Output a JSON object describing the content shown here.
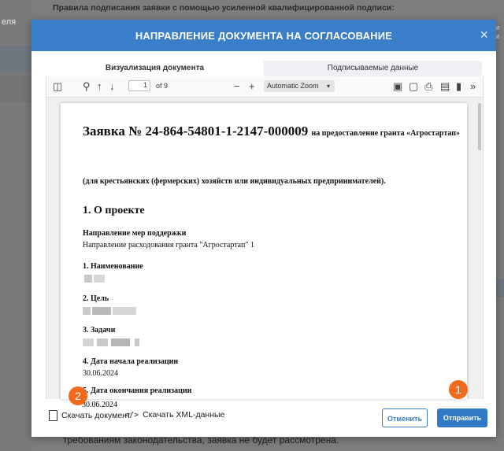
{
  "background": {
    "left_label": "еля",
    "top_text": "Правила подписания заявки с помощью усиленной квалифицированной подписи:",
    "bottom_text": "требованиям законодательства, заявка не будет рассмотрена.",
    "right_text": "и\nи"
  },
  "modal": {
    "title": "НАПРАВЛЕНИЕ ДОКУМЕНТА НА СОГЛАСОВАНИЕ",
    "close_symbol": "×",
    "tabs": [
      {
        "label": "Визуализация документа",
        "active": true
      },
      {
        "label": "Подписываемые данные",
        "active": false
      }
    ]
  },
  "viewer": {
    "page_value": "1",
    "page_count": "of 9",
    "zoom": "Automatic Zoom"
  },
  "document": {
    "title": "Заявка № 24-864-54801-1-2147-000009",
    "title_suffix": "на предоставление гранта «Агростартап»",
    "subtitle": "(для крестьянских (фермерских) хозяйств или индивидуальных предпринимателей).",
    "section": "1. О проекте",
    "fields": [
      {
        "label": "Направление мер поддержки",
        "value": "Направление расходования гранта \"Агростартап\" 1"
      },
      {
        "label": "1. Наименование",
        "value": ""
      },
      {
        "label": "2. Цель",
        "value": ""
      },
      {
        "label": "3. Задачи",
        "value": ""
      },
      {
        "label": "4. Дата начала реализации",
        "value": "30.06.2024"
      },
      {
        "label": "5. Дата окончания реализации",
        "value": "30.06.2024"
      }
    ]
  },
  "footer": {
    "download_doc": "Скачать документ",
    "download_xml": "Скачать XML-данные",
    "cancel": "Отменить",
    "send": "Отправить"
  },
  "badges": [
    "1",
    "2"
  ],
  "colors": {
    "header": "#3a7dc9",
    "primary_button": "#2f79c7",
    "badge": "#f26a1b"
  }
}
